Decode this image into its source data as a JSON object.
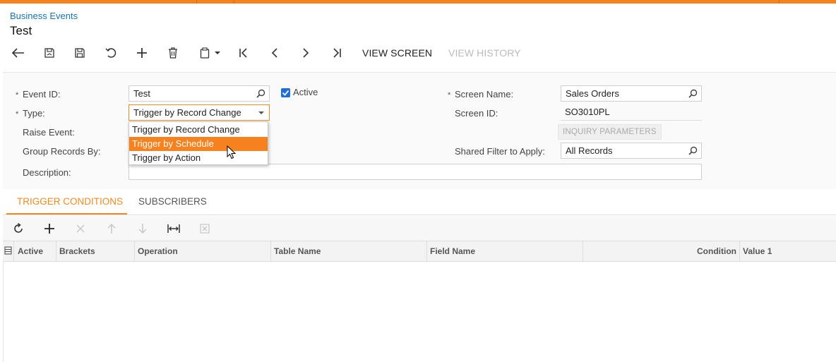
{
  "breadcrumb": "Business Events",
  "page_title": "Test",
  "toolbar": {
    "view_screen": "VIEW SCREEN",
    "view_history": "VIEW HISTORY"
  },
  "form": {
    "event_id_label": "Event ID:",
    "event_id_value": "Test",
    "active_label": "Active",
    "active_checked": true,
    "type_label": "Type:",
    "type_value": "Trigger by Record Change",
    "raise_event_label": "Raise Event:",
    "group_records_label": "Group Records By:",
    "description_label": "Description:",
    "description_value": "",
    "screen_name_label": "Screen Name:",
    "screen_name_value": "Sales Orders",
    "screen_id_label": "Screen ID:",
    "screen_id_value": "SO3010PL",
    "inquiry_parameters": "INQUIRY PARAMETERS",
    "shared_filter_label": "Shared Filter to Apply:",
    "shared_filter_value": "All Records",
    "required_mark": "*"
  },
  "type_dropdown": {
    "options": [
      "Trigger by Record Change",
      "Trigger by Schedule",
      "Trigger by Action"
    ],
    "highlighted": "Trigger by Schedule"
  },
  "tabs": [
    "TRIGGER CONDITIONS",
    "SUBSCRIBERS"
  ],
  "active_tab": "TRIGGER CONDITIONS",
  "grid": {
    "columns": [
      "Active",
      "Brackets",
      "Operation",
      "Table Name",
      "Field Name",
      "Condition",
      "Value 1"
    ],
    "rows": []
  },
  "colors": {
    "accent": "#f5821f",
    "link": "#1a73b5",
    "checkbox": "#1e6fd9"
  }
}
